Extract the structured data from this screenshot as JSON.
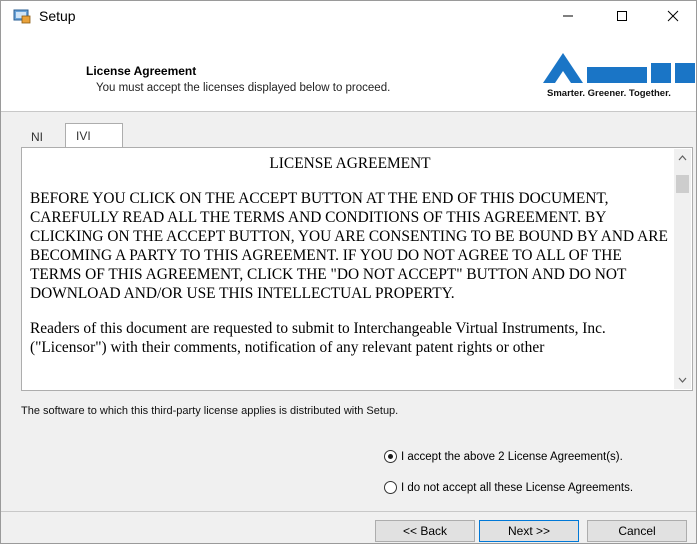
{
  "window": {
    "title": "Setup"
  },
  "header": {
    "title": "License Agreement",
    "subtitle": "You must accept the licenses displayed below to proceed.",
    "logo_text": "Smarter. Greener. Together."
  },
  "tabs": [
    {
      "label": "NI",
      "selected": false
    },
    {
      "label": "IVI",
      "selected": true
    }
  ],
  "license": {
    "heading": "LICENSE AGREEMENT",
    "paragraph1": "BEFORE YOU CLICK ON THE ACCEPT BUTTON AT THE END OF THIS DOCUMENT, CAREFULLY READ ALL THE TERMS AND CONDITIONS OF THIS AGREEMENT. BY CLICKING ON THE ACCEPT BUTTON, YOU ARE CONSENTING TO BE BOUND BY AND ARE BECOMING A PARTY TO THIS AGREEMENT. IF YOU DO NOT AGREE TO ALL OF THE TERMS OF THIS AGREEMENT, CLICK THE \"DO NOT ACCEPT\" BUTTON AND DO NOT DOWNLOAD AND/OR USE THIS INTELLECTUAL PROPERTY.",
    "paragraph2": "Readers of this document are requested to submit to Interchangeable Virtual Instruments, Inc. (\"Licensor\") with their comments, notification of any relevant patent rights or other"
  },
  "info_text": "The software to which this third-party license applies is distributed with Setup.",
  "options": {
    "accept_label": "I accept the above 2 License Agreement(s).",
    "decline_label": "I do not accept all these License Agreements.",
    "selected": "accept"
  },
  "buttons": {
    "back": "<< Back",
    "next": "Next >>",
    "cancel": "Cancel"
  },
  "colors": {
    "logo_blue": "#1a75c6",
    "focus_border": "#0078d7"
  }
}
